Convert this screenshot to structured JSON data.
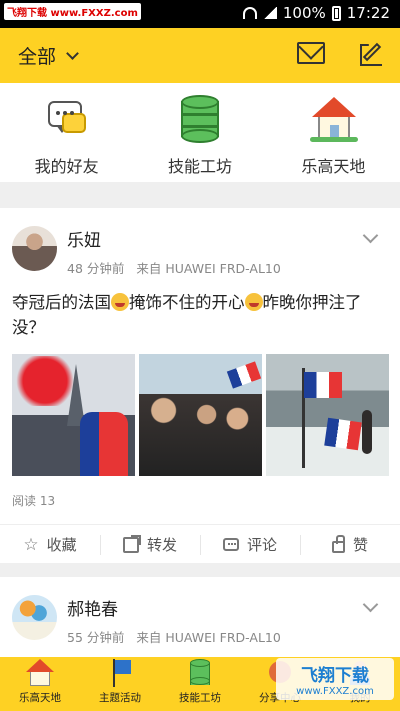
{
  "status_bar": {
    "watermark": "飞翔下载 www.FXXZ.com",
    "battery": "100%",
    "time": "17:22"
  },
  "header": {
    "title": "全部"
  },
  "shortcuts": [
    {
      "label": "我的好友",
      "icon": "chat-bubbles-icon"
    },
    {
      "label": "技能工坊",
      "icon": "database-icon"
    },
    {
      "label": "乐高天地",
      "icon": "house-icon"
    }
  ],
  "posts": [
    {
      "author": "乐妞",
      "time": "48 分钟前",
      "source": "来自 HUAWEI FRD-AL10",
      "text_part1": "夺冠后的法国",
      "text_part2": "掩饰不住的开心",
      "text_part3": "昨晚你押注了没？",
      "reads": "阅读 13"
    },
    {
      "author": "郝艳春",
      "time": "55 分钟前",
      "source": "来自 HUAWEI FRD-AL10"
    }
  ],
  "actions": {
    "favorite": "收藏",
    "repost": "转发",
    "comment": "评论",
    "like": "赞"
  },
  "bottom_nav": [
    {
      "label": "乐高天地"
    },
    {
      "label": "主题活动"
    },
    {
      "label": "技能工坊"
    },
    {
      "label": "分享中心"
    },
    {
      "label": "我的"
    }
  ],
  "watermark_br": {
    "title": "飞翔下载",
    "url": "www.FXXZ.com"
  },
  "colors": {
    "accent": "#fed123",
    "text": "#222222",
    "muted": "#888888"
  }
}
